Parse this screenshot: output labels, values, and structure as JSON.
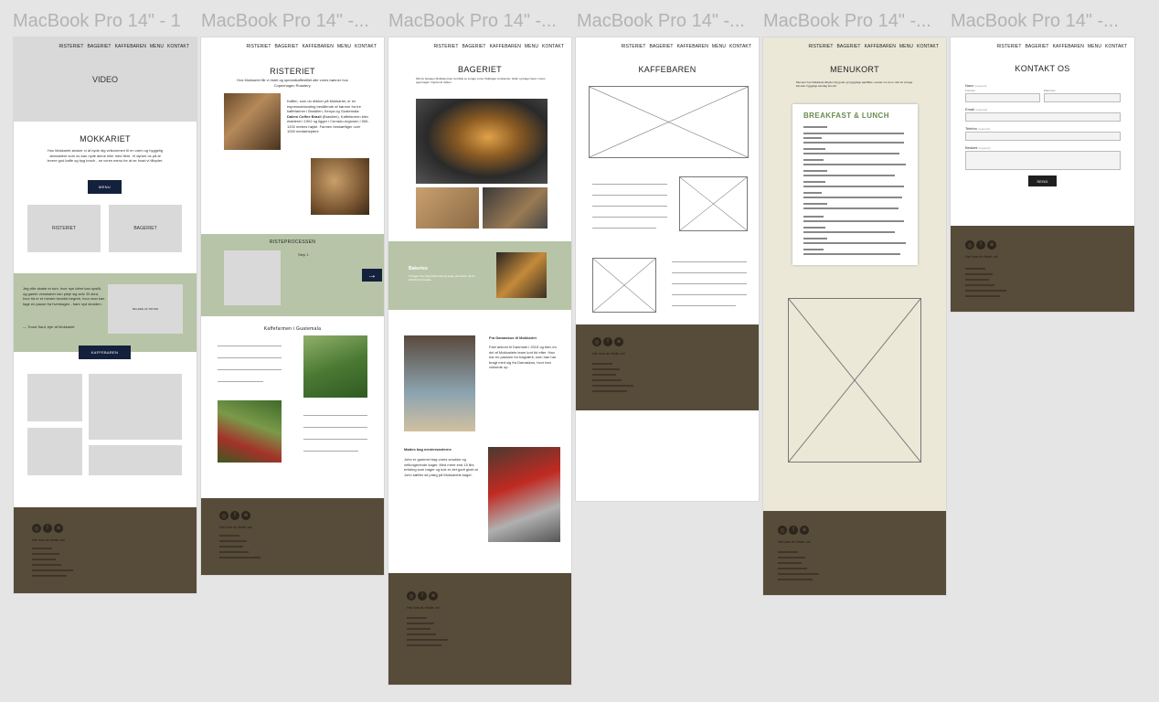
{
  "frame_titles": [
    "MacBook Pro 14\" - 1",
    "MacBook Pro 14\" -...",
    "MacBook Pro 14\" -...",
    "MacBook Pro 14\" -...",
    "MacBook Pro 14\" -...",
    "MacBook Pro 14\" -..."
  ],
  "nav": {
    "risteriet": "RISTERIET",
    "bageriet": "BAGERIET",
    "kaffebaren": "KAFFEBAREN",
    "menu": "MENU",
    "kontakt": "KONTAKT"
  },
  "footer": {
    "text": "Her kan du finde os!"
  },
  "frame1": {
    "video": "VIDEO",
    "title": "MOKKARIET",
    "intro": "Hos Mokkariet ønsker vi at byde dig velkommen til en varm og hyggelig atmosfære som du kan nyde alene eller med flere. Vi dyrker os på at levere god kaffe og byg bruch - se vores menu for at se hvad vi tilbyder.",
    "menu_button": "MENU",
    "card1": "RISTERIET",
    "card2": "BAGERIET",
    "quote": "Jeg ville skabe et rum, hvor nye idéer kan opstå, og gamle venskaber kan pleje sig selv. Et sted, hvor tid er et mindre bevidst begreb, hvor man kan tage en pause fra hverdagen - bare nyd stunden.",
    "quote_author": "— Trond Sauf, ejer af Mokkariet",
    "quote_box": "BILLEDE AF TROND",
    "kaffebaren_button": "KAFFEBAREN"
  },
  "frame2": {
    "title": "RISTERIET",
    "subtitle": "Hos Mokkariet får vi ristet og specialkaffestillet alle vores bønner hos Copenhagen Roastery.",
    "body": "Kaffen, som du drikker på Mokkariet, er en espressoblanding bestående af bønner fra tre kaffefarmer i Brasilien, Kenya og Guatemala:",
    "body_bold": "Dalem Coffee Brazil",
    "body2": "(Brasilien). Kaffefarmen blev etableret i 1902 og ligger i Cerrado-regionen i 900-1200 meters højde. Farmen beskæftiger over 1000 medarbejdere",
    "process": "RISTEPROCESSEN",
    "step": "Step 1",
    "arrow": "→",
    "farm": "Kaffefarmen i Guatemala"
  },
  "frame3": {
    "title": "BAGERIET",
    "intro": "Når du besøger Mokkariet kan du både se smage vores friskbagte croissanter, boller og kager lavet i vores eget bageri i hjertet af caféen.",
    "band_title": "Bakeries",
    "band_text": "Vi bager hver dag friskt brød og kager på stedet, så du altid får det bedste.",
    "section1_title": "Fra Damaskus til Mokkariet",
    "section1_text": "Fahi ankom til Danmark i 2015 og blev en del af Mokkariets team kort tid efter. Han har en passion for bagværk, som han har bragt med sig fra Damaskus, hvor han voksede op.",
    "section2_title": "Mødes bag mestersanterne",
    "section2_text": "John er gammel bag vores smukke og velfungerende kager. Med mere end 15 års erfaring som bager og kok er det godt givet at John sætter sit præg på Mokkariets kager."
  },
  "frame4": {
    "title": "KAFFEBAREN"
  },
  "frame5": {
    "title": "MENUKORT",
    "intro": "Menuen hos Mokkariet tilbyder dig gode og hyggelige øjeblikke, uanset om du er ude for at tage lidt eller hyggeligt søndag brunch.",
    "card_title": "BREAKFAST & LUNCH"
  },
  "frame6": {
    "title": "KONTAKT OS",
    "name": "Navn",
    "firstname": "Fornavn",
    "lastname": "Efternavn",
    "email": "Email",
    "phone": "Telefon",
    "message": "Besked",
    "send": "SEND",
    "required": "(required)"
  },
  "colors": {
    "green": "#b7c4a7",
    "footer": "#574b39",
    "button": "#14213d",
    "menu_bg": "#ebe8d8"
  }
}
